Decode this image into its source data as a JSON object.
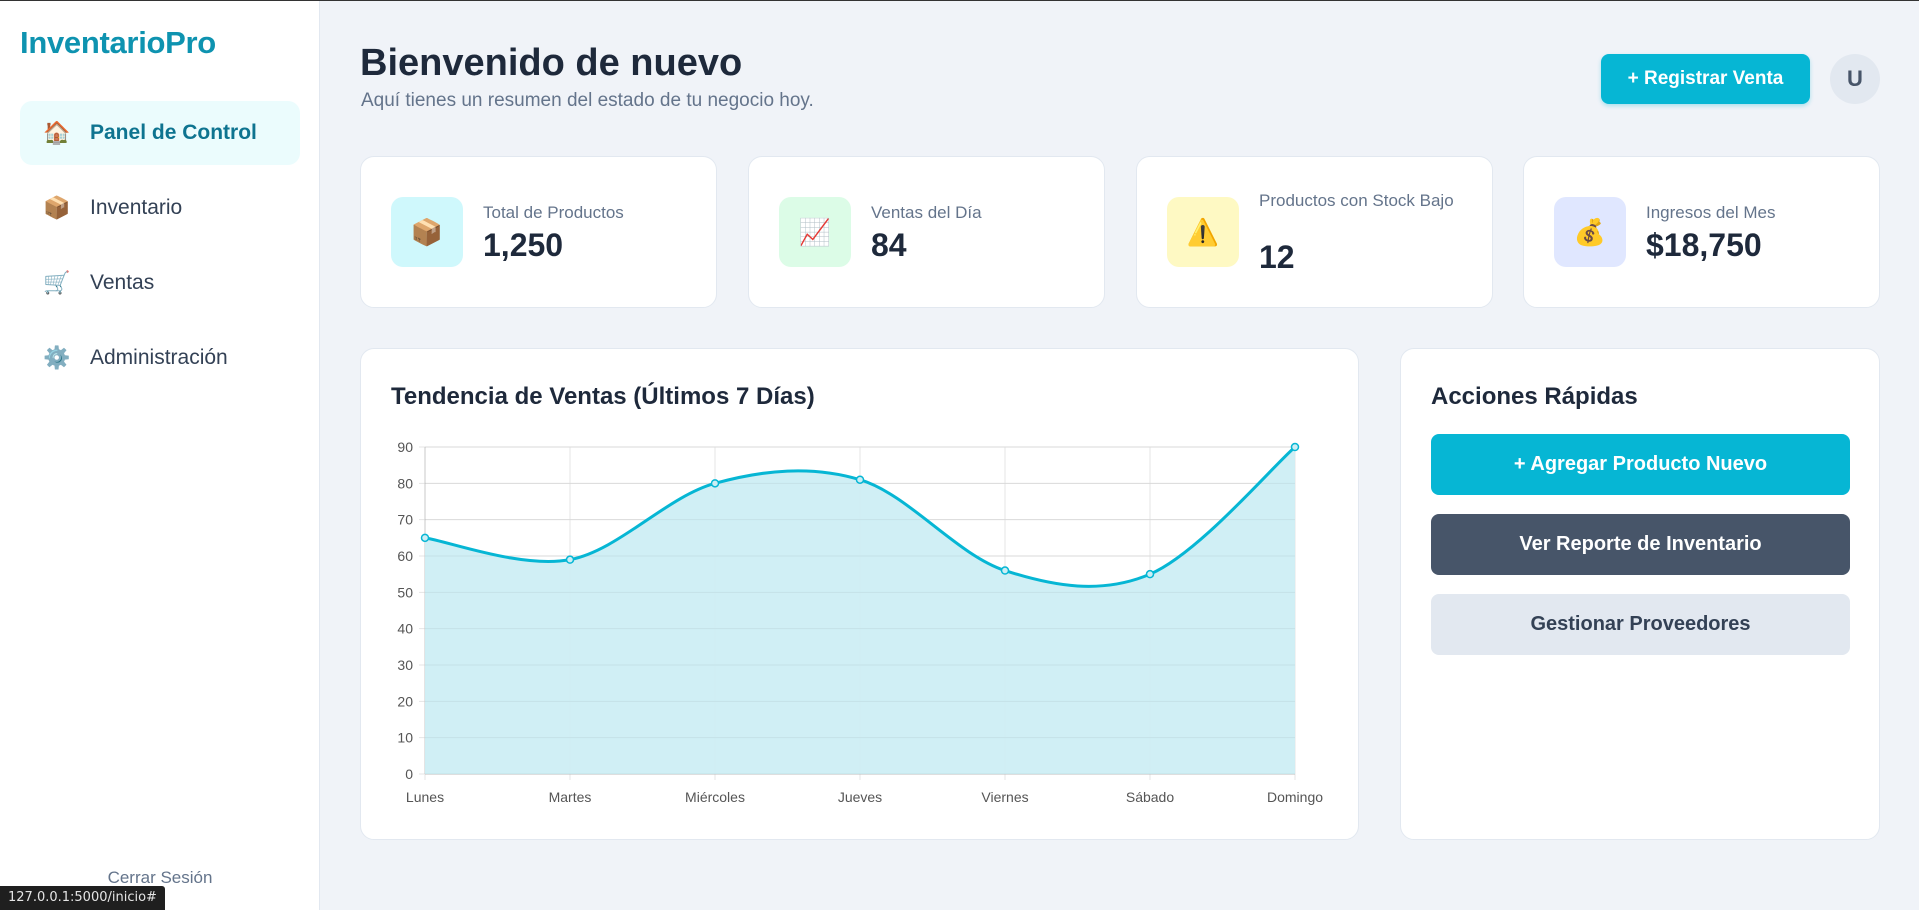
{
  "app": {
    "brand": "InventarioPro"
  },
  "sidebar": {
    "items": [
      {
        "label": "Panel de Control",
        "icon": "house-icon",
        "glyph": "🏠",
        "active": true
      },
      {
        "label": "Inventario",
        "icon": "package-icon",
        "glyph": "📦",
        "active": false
      },
      {
        "label": "Ventas",
        "icon": "shopping-cart-icon",
        "glyph": "🛒",
        "active": false
      },
      {
        "label": "Administración",
        "icon": "gear-icon",
        "glyph": "⚙️",
        "active": false
      }
    ],
    "logout": "Cerrar Sesión"
  },
  "header": {
    "title": "Bienvenido de nuevo",
    "subtitle": "Aquí tienes un resumen del estado de tu negocio hoy.",
    "register_sale": "+ Registrar Venta",
    "avatar_initial": "U"
  },
  "stats": [
    {
      "label": "Total de Productos",
      "value": "1,250",
      "icon": "package-icon",
      "glyph": "📦",
      "bg": "#cff8fc"
    },
    {
      "label": "Ventas del Día",
      "value": "84",
      "icon": "chart-increasing-icon",
      "glyph": "📈",
      "bg": "#dcfce7"
    },
    {
      "label": "Productos con Stock Bajo",
      "value": "12",
      "icon": "warning-icon",
      "glyph": "⚠️",
      "bg": "#fef9c3"
    },
    {
      "label": "Ingresos del Mes",
      "value": "$18,750",
      "icon": "money-bag-icon",
      "glyph": "💰",
      "bg": "#e0e7ff"
    }
  ],
  "chart": {
    "title": "Tendencia de Ventas (Últimos 7 Días)"
  },
  "chart_data": {
    "type": "area",
    "categories": [
      "Lunes",
      "Martes",
      "Miércoles",
      "Jueves",
      "Viernes",
      "Sábado",
      "Domingo"
    ],
    "values": [
      65,
      59,
      80,
      81,
      56,
      55,
      90
    ],
    "ylim": [
      0,
      90
    ],
    "yticks": [
      0,
      10,
      20,
      30,
      40,
      50,
      60,
      70,
      80,
      90
    ],
    "grid": true,
    "colors": {
      "line": "#06b6d4",
      "fill": "#cdeef4"
    }
  },
  "actions": {
    "title": "Acciones Rápidas",
    "add_product": "+ Agregar Producto Nuevo",
    "inventory_report": "Ver Reporte de Inventario",
    "manage_suppliers": "Gestionar Proveedores"
  },
  "browser": {
    "status_url": "127.0.0.1:5000/inicio#"
  },
  "colors": {
    "accent": "#06b6d4",
    "brand": "#0e93b0"
  }
}
